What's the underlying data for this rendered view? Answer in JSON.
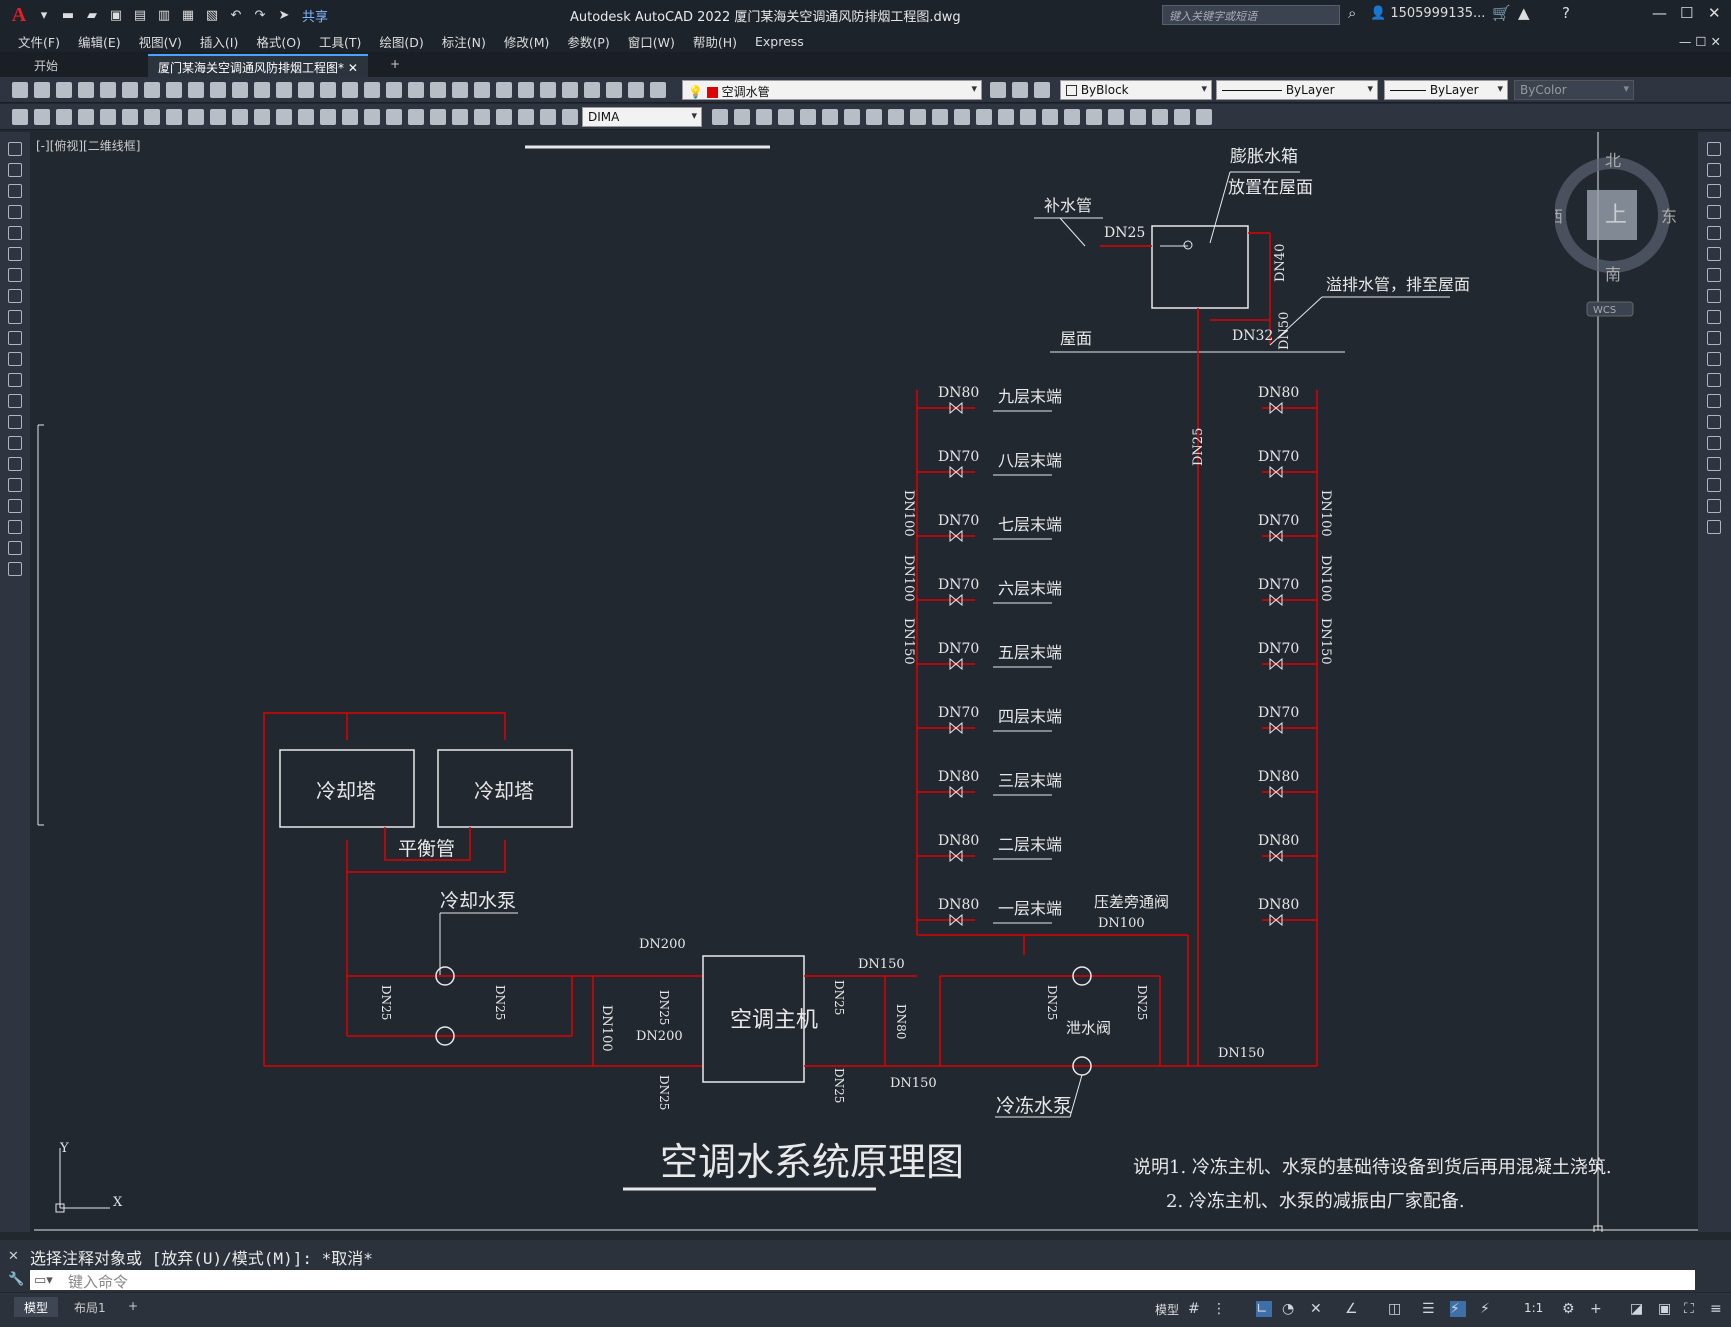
{
  "title_bar": {
    "app_title": "Autodesk AutoCAD 2022    厦门某海关空调通风防排烟工程图.dwg",
    "share_label": "共享",
    "search_placeholder": "键入关键字或短语",
    "user": "1505999135...",
    "quick_access_icons": [
      "new-icon",
      "open-icon",
      "save-icon",
      "saveas-icon",
      "open-web-icon",
      "save-web-icon",
      "plot-icon",
      "undo-icon",
      "redo-icon",
      "share-icon"
    ]
  },
  "menu": {
    "items": [
      "文件(F)",
      "编辑(E)",
      "视图(V)",
      "插入(I)",
      "格式(O)",
      "工具(T)",
      "绘图(D)",
      "标注(N)",
      "修改(M)",
      "参数(P)",
      "窗口(W)",
      "帮助(H)",
      "Express"
    ]
  },
  "doc_tabs": {
    "start": "开始",
    "active": "厦门某海关空调通风防排烟工程图*"
  },
  "toolbar": {
    "layer_name": "空调水管",
    "layer_color": "#e00000",
    "color_value": "ByBlock",
    "linetype_value": "ByLayer",
    "lineweight_value": "ByLayer",
    "plotstyle_value": "ByColor",
    "dimstyle_value": "DIMA"
  },
  "viewport": {
    "label": "[-][俯视][二维线框]",
    "viewcube": {
      "north": "北",
      "south": "南",
      "east": "东",
      "west": "西",
      "top": "上",
      "wcs": "WCS"
    }
  },
  "drawing": {
    "main_title": "空调水系统原理图",
    "expansion_tank": "膨胀水箱",
    "expansion_note": "放置在屋面",
    "makeup_pipe": "补水管",
    "overflow_pipe": "溢排水管，排至屋面",
    "roof": "屋面",
    "cooling_tower": "冷却塔",
    "balance_pipe": "平衡管",
    "cooling_pump": "冷却水泵",
    "chiller": "空调主机",
    "chilled_pump": "冷冻水泵",
    "drain_valve": "泄水阀",
    "bypass_valve": "压差旁通阀",
    "floors": [
      "九层末端",
      "八层末端",
      "七层末端",
      "六层末端",
      "五层末端",
      "四层末端",
      "三层末端",
      "二层末端",
      "一层末端"
    ],
    "floor_dn": [
      "DN80",
      "DN70",
      "DN70",
      "DN70",
      "DN70",
      "DN70",
      "DN80",
      "DN80",
      "DN80"
    ],
    "right_dn": [
      "DN80",
      "DN70",
      "DN70",
      "DN70",
      "DN70",
      "DN70",
      "DN80",
      "DN80",
      "DN80"
    ],
    "dn_labels": {
      "dn25": "DN25",
      "dn40": "DN40",
      "dn32": "DN32",
      "dn50": "DN50",
      "dn100": "DN100",
      "dn150": "DN150",
      "dn200": "DN200",
      "dn80": "DN80"
    },
    "notes": [
      "说明1. 冷冻主机、水泵的基础待设备到货后再用混凝土浇筑.",
      "2. 冷冻主机、水泵的减振由厂家配备."
    ]
  },
  "command": {
    "history": "选择注释对象或 [放弃(U)/模式(M)]: *取消*",
    "placeholder": "键入命令"
  },
  "status": {
    "model_tab": "模型",
    "layout_tab": "布局1",
    "model_label": "模型",
    "scale": "1:1"
  }
}
